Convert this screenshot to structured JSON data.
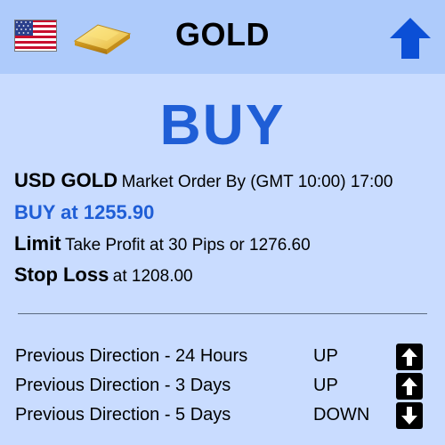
{
  "header": {
    "title": "GOLD",
    "flag_icon": "us-flag-icon",
    "asset_icon": "gold-bar-icon",
    "direction_icon": "up-arrow-icon",
    "accent": "#0b4fd6"
  },
  "signal": {
    "action": "BUY",
    "color": "#1f5ed6"
  },
  "order": {
    "pair": "USD GOLD",
    "market_order": "Market Order By (GMT 10:00) 17:00",
    "buy_at": "BUY at 1255.90",
    "limit_label": "Limit",
    "limit_text": "Take Profit at 30 Pips or 1276.60",
    "stop_label": "Stop Loss",
    "stop_text": "at 1208.00"
  },
  "history": [
    {
      "label": "Previous Direction - 24 Hours",
      "direction": "UP",
      "icon": "up-arrow-icon"
    },
    {
      "label": "Previous Direction - 3 Days",
      "direction": "UP",
      "icon": "up-arrow-icon"
    },
    {
      "label": "Previous Direction - 5 Days",
      "direction": "DOWN",
      "icon": "down-arrow-icon"
    }
  ]
}
